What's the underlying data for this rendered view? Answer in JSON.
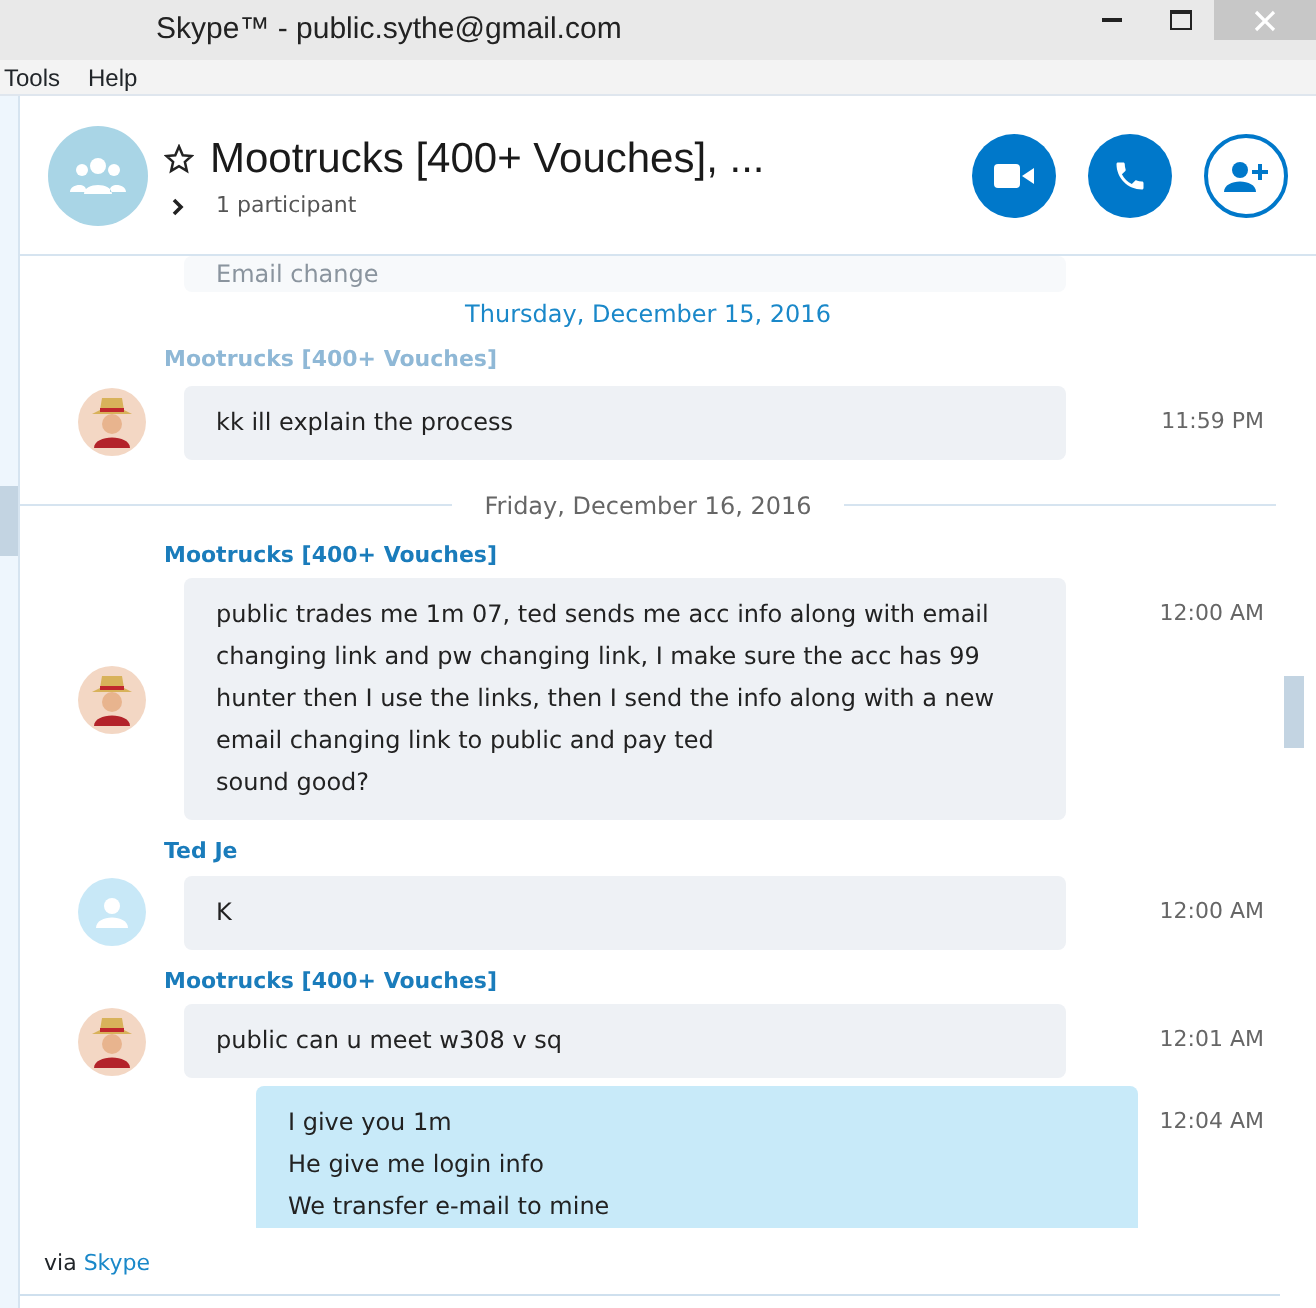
{
  "window": {
    "title": "Skype™ - public.sythe@gmail.com"
  },
  "menu": [
    "Tools",
    "Help"
  ],
  "conversation": {
    "title": "Mootrucks [400+ Vouches], ...",
    "favorite": false,
    "participants": "1 participant"
  },
  "timeline": [
    {
      "kind": "faded",
      "text": "Email change"
    },
    {
      "kind": "date",
      "text": "Thursday, December 15, 2016",
      "highlighted": true
    },
    {
      "kind": "faded-sender",
      "text": "Mootrucks [400+ Vouches]"
    },
    {
      "kind": "message",
      "avatar": {
        "kind": "figure"
      },
      "outgoing": false,
      "lines": [
        "kk ill explain the process"
      ],
      "time": "11:59 PM"
    },
    {
      "kind": "date",
      "text": "Friday, December 16, 2016",
      "highlighted": false
    },
    {
      "kind": "message",
      "sender": "Mootrucks [400+ Vouches]",
      "avatar": {
        "kind": "figure"
      },
      "outgoing": false,
      "lines": [
        "public trades me 1m 07, ted sends me acc info along with email changing link and pw changing link, I make sure the acc has 99 hunter then I use the links, then I send the info along with a new email changing link to public and pay ted",
        "sound good?"
      ],
      "time": "12:00 AM"
    },
    {
      "kind": "message",
      "sender": "Ted Je",
      "avatar": {
        "kind": "default"
      },
      "outgoing": false,
      "lines": [
        "K"
      ],
      "time": "12:00 AM"
    },
    {
      "kind": "message",
      "sender": "Mootrucks [400+ Vouches]",
      "avatar": {
        "kind": "figure"
      },
      "outgoing": false,
      "lines": [
        "public can u meet w308 v sq"
      ],
      "time": "12:01 AM"
    },
    {
      "kind": "message",
      "outgoing": true,
      "lines": [
        "I give you 1m",
        "He give me login info",
        "We transfer e-mail to mine"
      ],
      "time": "12:04 AM"
    }
  ],
  "footer": {
    "prefix": "via",
    "link": "Skype"
  }
}
